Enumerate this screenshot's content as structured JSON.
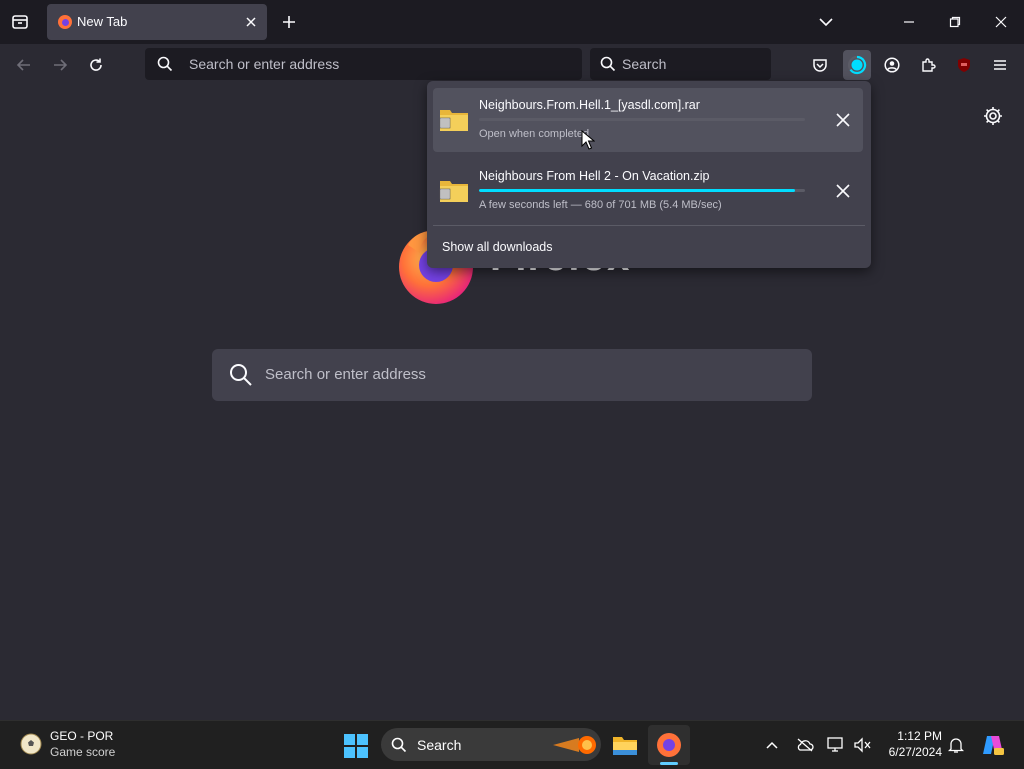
{
  "tabs": [
    {
      "title": "New Tab"
    }
  ],
  "navbar": {
    "url_placeholder": "Search or enter address",
    "search_placeholder": "Search"
  },
  "newtab": {
    "brand": "Firefox",
    "search_placeholder": "Search or enter address"
  },
  "downloads": {
    "items": [
      {
        "name": "Neighbours.From.Hell.1_[yasdl.com].rar",
        "status": "Open when completed",
        "progress": 0.0
      },
      {
        "name": "Neighbours From Hell 2 - On Vacation.zip",
        "status": "A few seconds left — 680 of 701 MB (5.4 MB/sec)",
        "progress": 0.97
      }
    ],
    "show_all_label": "Show all downloads"
  },
  "taskbar": {
    "weather_title": "GEO - POR",
    "weather_subtitle": "Game score",
    "search_label": "Search",
    "time": "1:12 PM",
    "date": "6/27/2024"
  },
  "colors": {
    "accent": "#00ddff",
    "chrome_dark": "#1c1b22",
    "content_bg": "#2b2a33",
    "panel_bg": "#42414d"
  }
}
